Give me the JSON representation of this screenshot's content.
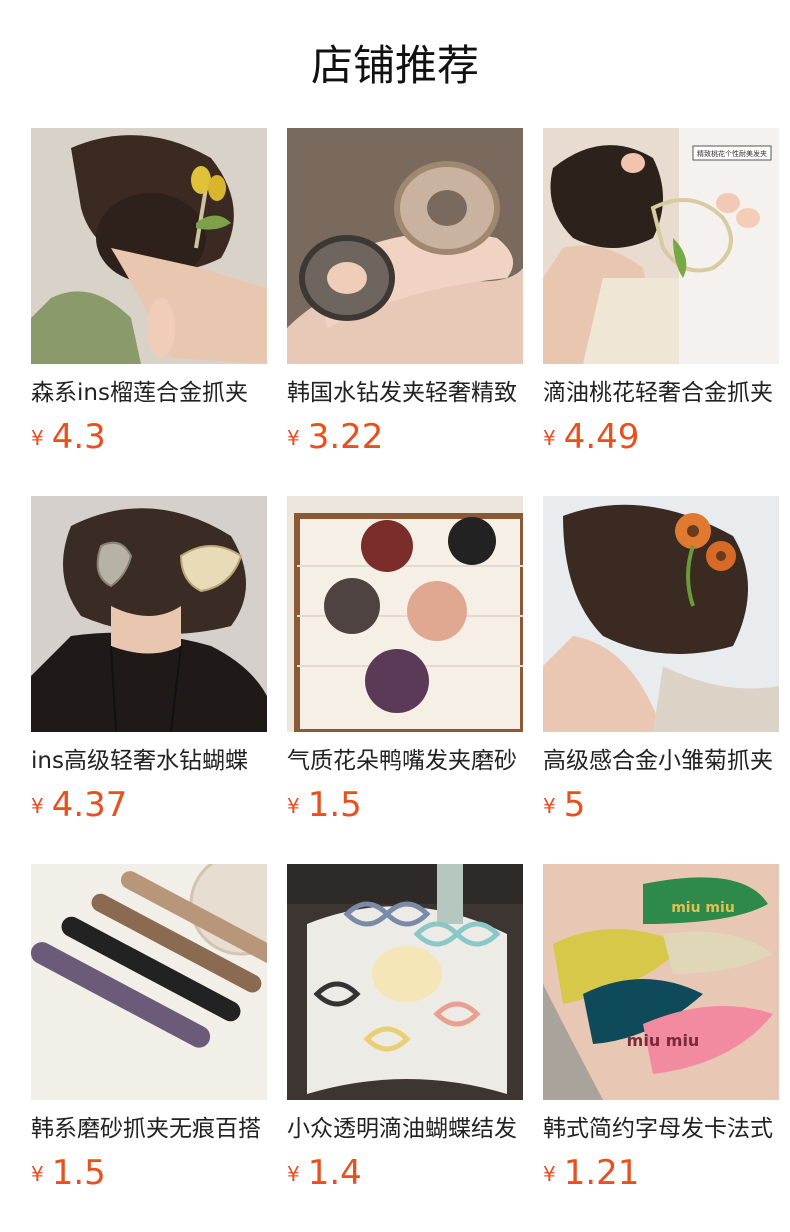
{
  "header": {
    "title": "店铺推荐"
  },
  "products": [
    {
      "name": "森系ins榴莲合金抓夹",
      "currency": "¥",
      "price": "4.3",
      "image": "hair-clip-yellow-tulip-photo"
    },
    {
      "name": "韩国水钻发夹轻奢精致",
      "currency": "¥",
      "price": "3.22",
      "image": "rhinestone-heart-clips-photo"
    },
    {
      "name": "滴油桃花轻奢合金抓夹",
      "currency": "¥",
      "price": "4.49",
      "image": "peach-blossom-claw-clip-photo",
      "image_caption": "精致桃花个性耐美发夹"
    },
    {
      "name": "ins高级轻奢水钻蝴蝶",
      "currency": "¥",
      "price": "4.37",
      "image": "rhinestone-butterfly-clips-photo"
    },
    {
      "name": "气质花朵鸭嘴发夹磨砂",
      "currency": "¥",
      "price": "1.5",
      "image": "matte-flower-duckbill-clips-photo"
    },
    {
      "name": "高级感合金小雏菊抓夹",
      "currency": "¥",
      "price": "5",
      "image": "daisy-alloy-claw-clip-photo"
    },
    {
      "name": "韩系磨砂抓夹无痕百搭",
      "currency": "¥",
      "price": "1.5",
      "image": "matte-banana-clips-photo"
    },
    {
      "name": "小众透明滴油蝴蝶结发",
      "currency": "¥",
      "price": "1.4",
      "image": "transparent-bow-clips-photo"
    },
    {
      "name": "韩式简约字母发卡法式",
      "currency": "¥",
      "price": "1.21",
      "image": "letter-snap-hair-clips-photo",
      "image_text": "miu miu"
    }
  ],
  "colors": {
    "price": "#e8501f",
    "title": "#111111",
    "text": "#222222"
  }
}
